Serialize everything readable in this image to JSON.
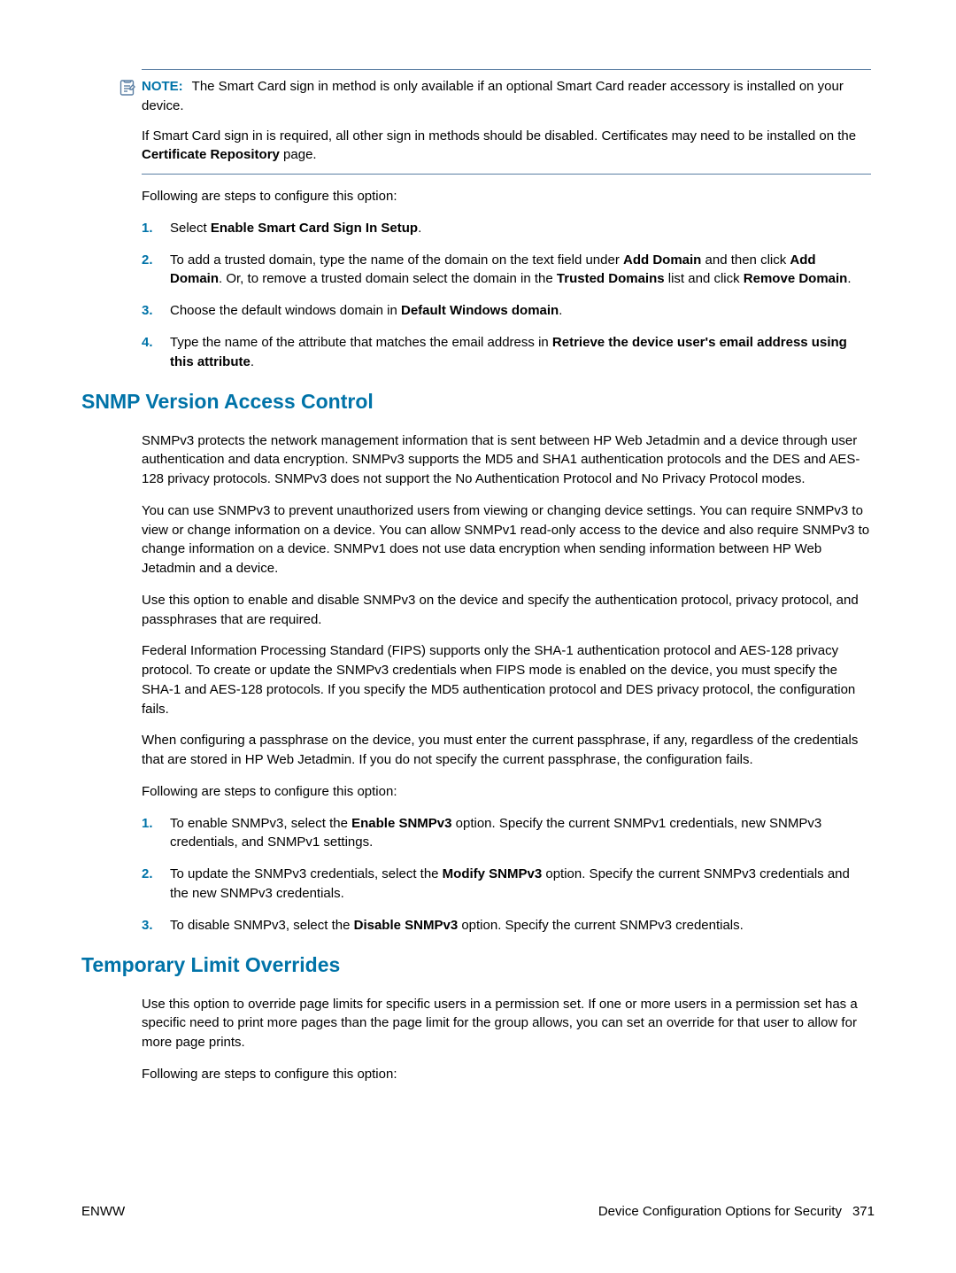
{
  "note": {
    "label": "NOTE:",
    "p1_a": "The Smart Card sign in method is only available if an optional Smart Card reader accessory is installed on your device.",
    "p2_a": "If Smart Card sign in is required, all other sign in methods should be disabled. Certificates may need to be installed on the ",
    "p2_b": "Certificate Repository",
    "p2_c": " page."
  },
  "smartcard": {
    "intro": "Following are steps to configure this option:",
    "s1_a": "Select ",
    "s1_b": "Enable Smart Card Sign In Setup",
    "s1_c": ".",
    "s2_a": "To add a trusted domain, type the name of the domain on the text field under ",
    "s2_b": "Add Domain",
    "s2_c": " and then click ",
    "s2_d": "Add Domain",
    "s2_e": ". Or, to remove a trusted domain select the domain in the ",
    "s2_f": "Trusted Domains",
    "s2_g": " list and click ",
    "s2_h": "Remove Domain",
    "s2_i": ".",
    "s3_a": "Choose the default windows domain in ",
    "s3_b": "Default Windows domain",
    "s3_c": ".",
    "s4_a": "Type the name of the attribute that matches the email address in ",
    "s4_b": "Retrieve the device user's email address using this attribute",
    "s4_c": "."
  },
  "snmp": {
    "heading": "SNMP Version Access Control",
    "p1": "SNMPv3 protects the network management information that is sent between HP Web Jetadmin and a device through user authentication and data encryption. SNMPv3 supports the MD5 and SHA1 authentication protocols and the DES and AES-128 privacy protocols. SNMPv3 does not support the No Authentication Protocol and No Privacy Protocol modes.",
    "p2": "You can use SNMPv3 to prevent unauthorized users from viewing or changing device settings. You can require SNMPv3 to view or change information on a device. You can allow SNMPv1 read-only access to the device and also require SNMPv3 to change information on a device. SNMPv1 does not use data encryption when sending information between HP Web Jetadmin and a device.",
    "p3": "Use this option to enable and disable SNMPv3 on the device and specify the authentication protocol, privacy protocol, and passphrases that are required.",
    "p4": "Federal Information Processing Standard (FIPS) supports only the SHA-1 authentication protocol and AES-128 privacy protocol. To create or update the SNMPv3 credentials when FIPS mode is enabled on the device, you must specify the SHA-1 and AES-128 protocols. If you specify the MD5 authentication protocol and DES privacy protocol, the configuration fails.",
    "p5": "When configuring a passphrase on the device, you must enter the current passphrase, if any, regardless of the credentials that are stored in HP Web Jetadmin. If you do not specify the current passphrase, the configuration fails.",
    "intro": "Following are steps to configure this option:",
    "s1_a": "To enable SNMPv3, select the ",
    "s1_b": "Enable SNMPv3",
    "s1_c": " option. Specify the current SNMPv1 credentials, new SNMPv3 credentials, and SNMPv1 settings.",
    "s2_a": "To update the SNMPv3 credentials, select the ",
    "s2_b": "Modify SNMPv3",
    "s2_c": " option. Specify the current SNMPv3 credentials and the new SNMPv3 credentials.",
    "s3_a": "To disable SNMPv3, select the ",
    "s3_b": "Disable SNMPv3",
    "s3_c": " option. Specify the current SNMPv3 credentials."
  },
  "tlo": {
    "heading": "Temporary Limit Overrides",
    "p1": "Use this option to override page limits for specific users in a permission set. If one or more users in a permission set has a specific need to print more pages than the page limit for the group allows, you can set an override for that user to allow for more page prints.",
    "intro": "Following are steps to configure this option:"
  },
  "footer": {
    "left": "ENWW",
    "right": "Device Configuration Options for Security",
    "page": "371"
  },
  "nums": {
    "n1": "1.",
    "n2": "2.",
    "n3": "3.",
    "n4": "4."
  }
}
